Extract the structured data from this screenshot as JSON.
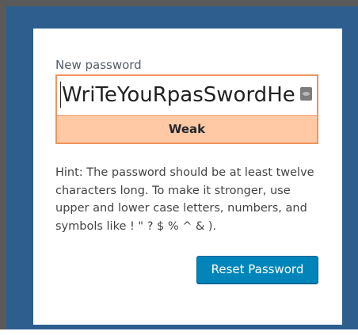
{
  "form": {
    "label": "New password",
    "password_value": "WriTeYouRpasSwordHe",
    "strength_label": "Weak",
    "hint": "Hint: The password should be at least twelve characters long. To make it stronger, use upper and lower case letters, numbers, and symbols like ! \" ? $ % ^ & ).",
    "reset_button_label": "Reset Password",
    "visibility_toggle_icon": "eye-icon"
  },
  "colors": {
    "frame": "#2d5e8e",
    "strength_weak_bg": "#ffc9a6",
    "strength_weak_border": "#f0935a",
    "button_primary": "#0085ba"
  }
}
